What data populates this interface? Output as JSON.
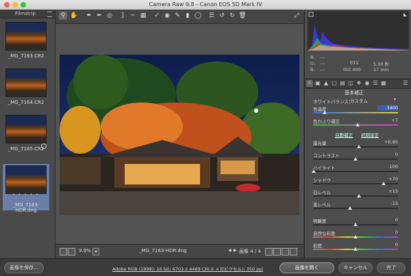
{
  "window": {
    "title": "Camera Raw 9.8  -  Canon EOS 5D Mark IV"
  },
  "filmstrip": {
    "title": "Filmstrip",
    "items": [
      {
        "label": "_MG_7163.CR2",
        "selected": false
      },
      {
        "label": "_MG_7164.CR2",
        "selected": false
      },
      {
        "label": "_MG_7165.CR2",
        "selected": false
      },
      {
        "label": "_MG_7163-HDR.dng",
        "selected": true,
        "stars": "• • • • •"
      }
    ]
  },
  "toolbar": {
    "tools": [
      "zoom-icon",
      "hand-icon",
      "white-balance-icon",
      "color-sampler-icon",
      "targeted-adjust-icon",
      "crop-icon",
      "straighten-icon",
      "transform-icon",
      "spot-removal-icon",
      "red-eye-icon",
      "adjustment-brush-icon",
      "graduated-filter-icon",
      "radial-filter-icon",
      "preferences-icon",
      "rotate-ccw-icon",
      "rotate-cw-icon",
      "trash-icon"
    ]
  },
  "status": {
    "zoom": "9.9%",
    "filename": "_MG_7163-HDR.dng",
    "image_count": "画像 4 / 4"
  },
  "readout": {
    "r_label": "R:",
    "r_value": "---",
    "g_label": "G:",
    "g_value": "---",
    "b_label": "B:",
    "b_value": "---",
    "aperture": "f/11",
    "shutter": "5.00 秒",
    "iso": "ISO 400",
    "focal": "17 mm"
  },
  "panel": {
    "title": "基本補正",
    "wb_label": "ホワイトバランス：",
    "wb_value": "カスタム",
    "auto": "自動補正",
    "default": "初期設定",
    "sliders": [
      {
        "label": "色温度",
        "value": "3400",
        "pos": 0.1
      },
      {
        "label": "色かぶり補正",
        "value": "+7",
        "pos": 0.52
      },
      {
        "label": "露光量",
        "value": "+0.85",
        "pos": 0.57
      },
      {
        "label": "コントラスト",
        "value": "0",
        "pos": 0.5
      },
      {
        "label": "ハイライト",
        "value": "-100",
        "pos": 0.0
      },
      {
        "label": "シャドウ",
        "value": "+70",
        "pos": 0.85
      },
      {
        "label": "白レベル",
        "value": "+15",
        "pos": 0.57
      },
      {
        "label": "黒レベル",
        "value": "-15",
        "pos": 0.43
      },
      {
        "label": "明瞭度",
        "value": "0",
        "pos": 0.5
      },
      {
        "label": "自然な彩度",
        "value": "0",
        "pos": 0.5
      },
      {
        "label": "彩度",
        "value": "0",
        "pos": 0.5
      }
    ]
  },
  "bottom": {
    "save_label": "画像を保存...",
    "info_link": "Adobe RGB (1998); 16 bit; 6703 x 4469 (30.0 メガピクセル); 350 ppi",
    "open_label": "画像を開く",
    "cancel_label": "キャンセル",
    "done_label": "完了"
  }
}
